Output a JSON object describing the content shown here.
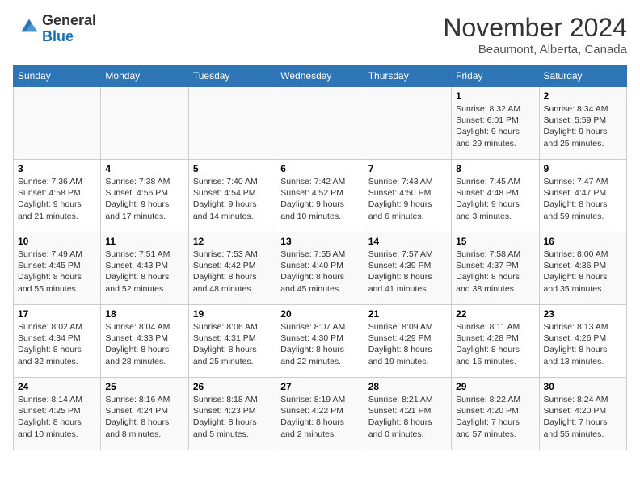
{
  "logo": {
    "general": "General",
    "blue": "Blue"
  },
  "title": "November 2024",
  "subtitle": "Beaumont, Alberta, Canada",
  "days_of_week": [
    "Sunday",
    "Monday",
    "Tuesday",
    "Wednesday",
    "Thursday",
    "Friday",
    "Saturday"
  ],
  "weeks": [
    [
      {
        "day": "",
        "info": ""
      },
      {
        "day": "",
        "info": ""
      },
      {
        "day": "",
        "info": ""
      },
      {
        "day": "",
        "info": ""
      },
      {
        "day": "",
        "info": ""
      },
      {
        "day": "1",
        "info": "Sunrise: 8:32 AM\nSunset: 6:01 PM\nDaylight: 9 hours and 29 minutes."
      },
      {
        "day": "2",
        "info": "Sunrise: 8:34 AM\nSunset: 5:59 PM\nDaylight: 9 hours and 25 minutes."
      }
    ],
    [
      {
        "day": "3",
        "info": "Sunrise: 7:36 AM\nSunset: 4:58 PM\nDaylight: 9 hours and 21 minutes."
      },
      {
        "day": "4",
        "info": "Sunrise: 7:38 AM\nSunset: 4:56 PM\nDaylight: 9 hours and 17 minutes."
      },
      {
        "day": "5",
        "info": "Sunrise: 7:40 AM\nSunset: 4:54 PM\nDaylight: 9 hours and 14 minutes."
      },
      {
        "day": "6",
        "info": "Sunrise: 7:42 AM\nSunset: 4:52 PM\nDaylight: 9 hours and 10 minutes."
      },
      {
        "day": "7",
        "info": "Sunrise: 7:43 AM\nSunset: 4:50 PM\nDaylight: 9 hours and 6 minutes."
      },
      {
        "day": "8",
        "info": "Sunrise: 7:45 AM\nSunset: 4:48 PM\nDaylight: 9 hours and 3 minutes."
      },
      {
        "day": "9",
        "info": "Sunrise: 7:47 AM\nSunset: 4:47 PM\nDaylight: 8 hours and 59 minutes."
      }
    ],
    [
      {
        "day": "10",
        "info": "Sunrise: 7:49 AM\nSunset: 4:45 PM\nDaylight: 8 hours and 55 minutes."
      },
      {
        "day": "11",
        "info": "Sunrise: 7:51 AM\nSunset: 4:43 PM\nDaylight: 8 hours and 52 minutes."
      },
      {
        "day": "12",
        "info": "Sunrise: 7:53 AM\nSunset: 4:42 PM\nDaylight: 8 hours and 48 minutes."
      },
      {
        "day": "13",
        "info": "Sunrise: 7:55 AM\nSunset: 4:40 PM\nDaylight: 8 hours and 45 minutes."
      },
      {
        "day": "14",
        "info": "Sunrise: 7:57 AM\nSunset: 4:39 PM\nDaylight: 8 hours and 41 minutes."
      },
      {
        "day": "15",
        "info": "Sunrise: 7:58 AM\nSunset: 4:37 PM\nDaylight: 8 hours and 38 minutes."
      },
      {
        "day": "16",
        "info": "Sunrise: 8:00 AM\nSunset: 4:36 PM\nDaylight: 8 hours and 35 minutes."
      }
    ],
    [
      {
        "day": "17",
        "info": "Sunrise: 8:02 AM\nSunset: 4:34 PM\nDaylight: 8 hours and 32 minutes."
      },
      {
        "day": "18",
        "info": "Sunrise: 8:04 AM\nSunset: 4:33 PM\nDaylight: 8 hours and 28 minutes."
      },
      {
        "day": "19",
        "info": "Sunrise: 8:06 AM\nSunset: 4:31 PM\nDaylight: 8 hours and 25 minutes."
      },
      {
        "day": "20",
        "info": "Sunrise: 8:07 AM\nSunset: 4:30 PM\nDaylight: 8 hours and 22 minutes."
      },
      {
        "day": "21",
        "info": "Sunrise: 8:09 AM\nSunset: 4:29 PM\nDaylight: 8 hours and 19 minutes."
      },
      {
        "day": "22",
        "info": "Sunrise: 8:11 AM\nSunset: 4:28 PM\nDaylight: 8 hours and 16 minutes."
      },
      {
        "day": "23",
        "info": "Sunrise: 8:13 AM\nSunset: 4:26 PM\nDaylight: 8 hours and 13 minutes."
      }
    ],
    [
      {
        "day": "24",
        "info": "Sunrise: 8:14 AM\nSunset: 4:25 PM\nDaylight: 8 hours and 10 minutes."
      },
      {
        "day": "25",
        "info": "Sunrise: 8:16 AM\nSunset: 4:24 PM\nDaylight: 8 hours and 8 minutes."
      },
      {
        "day": "26",
        "info": "Sunrise: 8:18 AM\nSunset: 4:23 PM\nDaylight: 8 hours and 5 minutes."
      },
      {
        "day": "27",
        "info": "Sunrise: 8:19 AM\nSunset: 4:22 PM\nDaylight: 8 hours and 2 minutes."
      },
      {
        "day": "28",
        "info": "Sunrise: 8:21 AM\nSunset: 4:21 PM\nDaylight: 8 hours and 0 minutes."
      },
      {
        "day": "29",
        "info": "Sunrise: 8:22 AM\nSunset: 4:20 PM\nDaylight: 7 hours and 57 minutes."
      },
      {
        "day": "30",
        "info": "Sunrise: 8:24 AM\nSunset: 4:20 PM\nDaylight: 7 hours and 55 minutes."
      }
    ]
  ]
}
